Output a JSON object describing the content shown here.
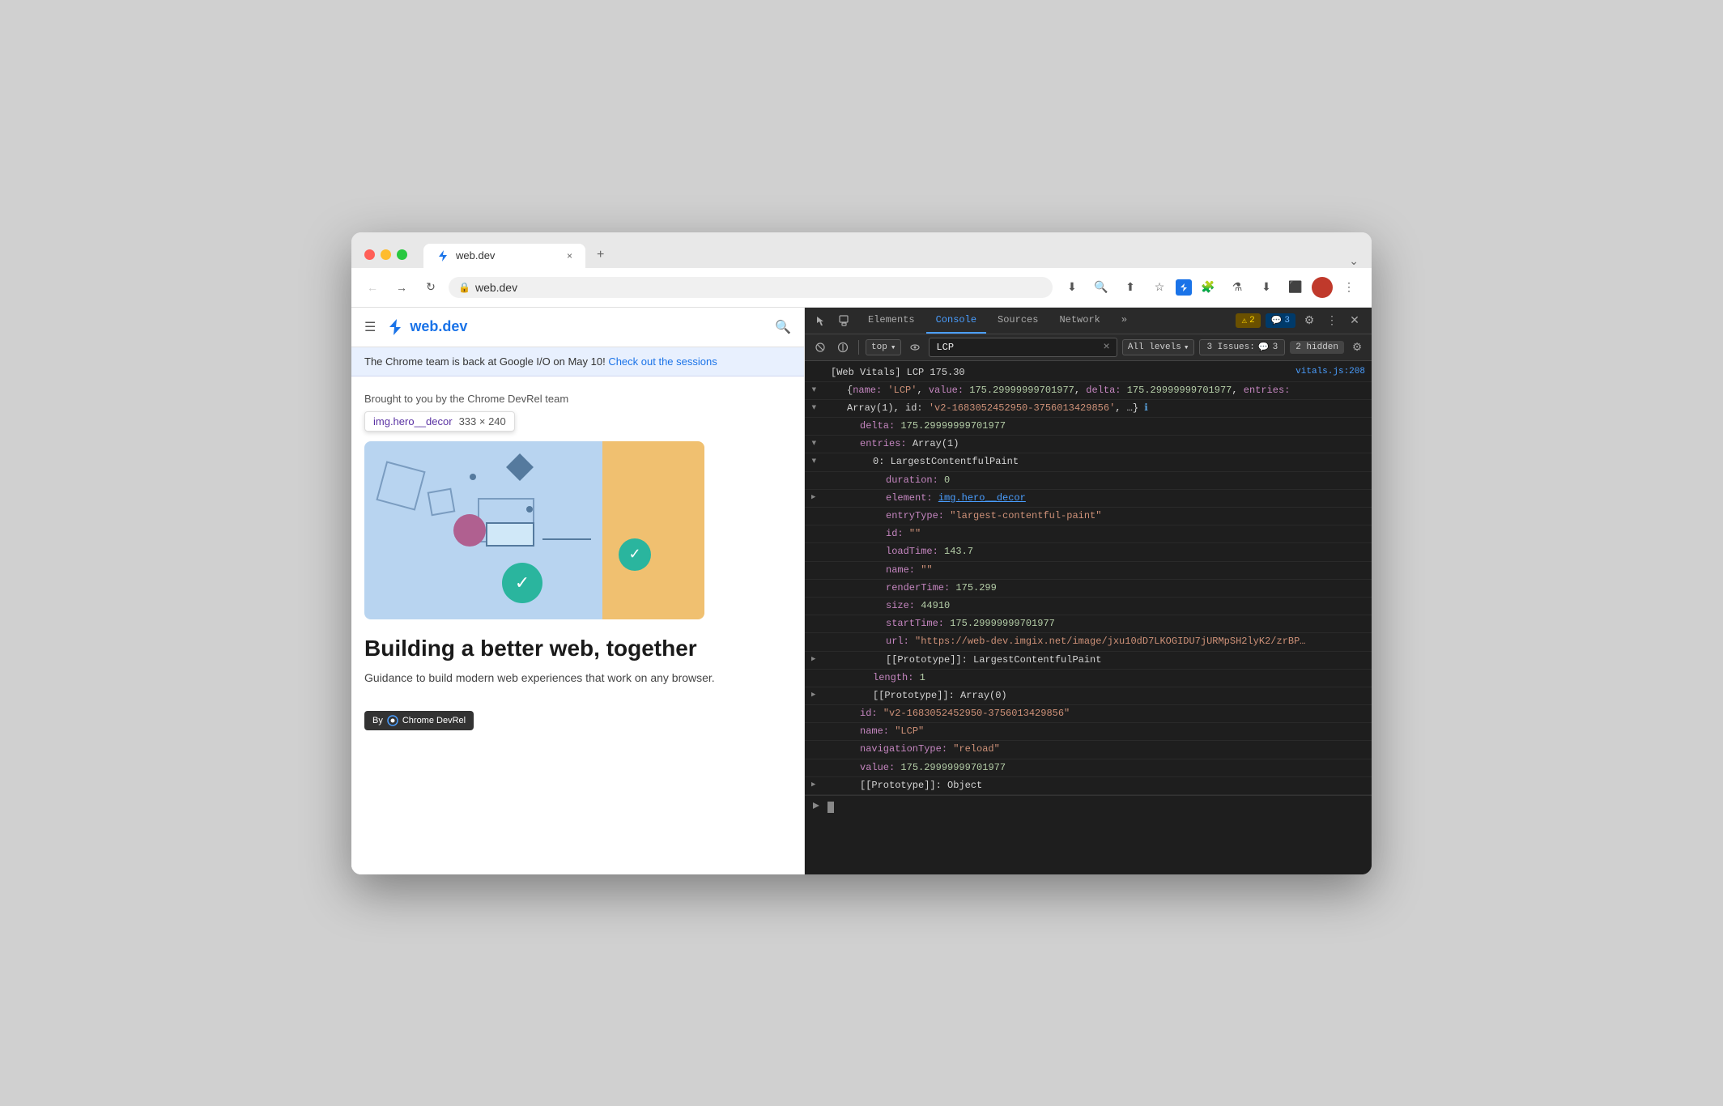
{
  "browser": {
    "traffic_lights": [
      "red",
      "yellow",
      "green"
    ],
    "tab": {
      "title": "web.dev",
      "close_label": "×",
      "new_tab_label": "+"
    },
    "nav": {
      "back_label": "←",
      "forward_label": "→",
      "refresh_label": "↻",
      "address": "web.dev",
      "lock_icon": "🔒",
      "bookmark_label": "☆",
      "more_label": "⋮"
    }
  },
  "page": {
    "nav": {
      "hamburger_label": "≡",
      "site_name": "web.dev",
      "search_label": "🔍"
    },
    "announcement": {
      "text": "The Chrome team is back at Google I/O on May 10! ",
      "link_text": "Check out the sessions"
    },
    "hero": {
      "by_text": "Brought to you by the Chrome DevRel team",
      "element_tooltip": {
        "tag": "img.hero__decor",
        "size": "333 × 240"
      },
      "title": "Building a better web, together",
      "subtitle": "Guidance to build modern web experiences that work on any browser."
    },
    "footer_badge": {
      "label": "By",
      "name": "Chrome DevRel"
    }
  },
  "devtools": {
    "tabs": [
      "Elements",
      "Console",
      "Sources",
      "Network"
    ],
    "active_tab": "Console",
    "more_tabs_label": "»",
    "badges": {
      "warn_icon": "⚠",
      "warn_count": "2",
      "info_icon": "💬",
      "info_count": "3"
    },
    "toolbar": {
      "clear_label": "🚫",
      "stop_label": "⊘",
      "context": "top",
      "eye_label": "👁",
      "filter_value": "LCP",
      "filter_clear": "×",
      "level": "All levels",
      "issues_label": "3 Issues:",
      "issues_count": "3",
      "hidden_count": "2 hidden"
    },
    "console_output": [
      {
        "type": "log",
        "gutter": "",
        "indent": 0,
        "content": "[Web Vitals] LCP 175.30",
        "source": "vitals.js:208",
        "parts": [
          {
            "text": "[Web Vitals] LCP 175.30",
            "class": "c-white"
          }
        ]
      },
      {
        "type": "obj",
        "indent": 1,
        "expand": true,
        "parts": [
          {
            "text": "{",
            "class": "c-white"
          },
          {
            "text": "name: ",
            "class": "c-purple"
          },
          {
            "text": "'LCP'",
            "class": "c-orange"
          },
          {
            "text": ", value: ",
            "class": "c-purple"
          },
          {
            "text": "175.29999999701977",
            "class": "c-num"
          },
          {
            "text": ", delta: ",
            "class": "c-purple"
          },
          {
            "text": "175.29999999701977",
            "class": "c-num"
          },
          {
            "text": ", entries:",
            "class": "c-purple"
          }
        ]
      },
      {
        "type": "obj",
        "indent": 1,
        "expand": true,
        "parts": [
          {
            "text": "Array(1), id: ",
            "class": "c-white"
          },
          {
            "text": "'v2-1683052452950-3756013429856'",
            "class": "c-orange"
          },
          {
            "text": ", …}",
            "class": "c-white"
          },
          {
            "text": " ℹ",
            "class": "c-blue"
          }
        ]
      },
      {
        "type": "prop",
        "indent": 2,
        "parts": [
          {
            "text": "delta: ",
            "class": "c-purple"
          },
          {
            "text": "175.29999999701977",
            "class": "c-num"
          }
        ]
      },
      {
        "type": "prop-expand",
        "indent": 2,
        "expand": true,
        "parts": [
          {
            "text": "entries: ",
            "class": "c-purple"
          },
          {
            "text": "Array(1)",
            "class": "c-white"
          }
        ]
      },
      {
        "type": "prop-expand",
        "indent": 3,
        "expand": true,
        "parts": [
          {
            "text": "0: LargestContentfulPaint",
            "class": "c-white"
          }
        ]
      },
      {
        "type": "prop",
        "indent": 4,
        "parts": [
          {
            "text": "duration: ",
            "class": "c-purple"
          },
          {
            "text": "0",
            "class": "c-num"
          }
        ]
      },
      {
        "type": "prop-expand",
        "indent": 4,
        "expand": false,
        "parts": [
          {
            "text": "element: ",
            "class": "c-purple"
          },
          {
            "text": "img.hero__decor",
            "class": "c-link"
          }
        ]
      },
      {
        "type": "prop",
        "indent": 4,
        "parts": [
          {
            "text": "entryType: ",
            "class": "c-purple"
          },
          {
            "text": "\"largest-contentful-paint\"",
            "class": "c-orange"
          }
        ]
      },
      {
        "type": "prop",
        "indent": 4,
        "parts": [
          {
            "text": "id: ",
            "class": "c-purple"
          },
          {
            "text": "\"\"",
            "class": "c-orange"
          }
        ]
      },
      {
        "type": "prop",
        "indent": 4,
        "parts": [
          {
            "text": "loadTime: ",
            "class": "c-purple"
          },
          {
            "text": "143.7",
            "class": "c-num"
          }
        ]
      },
      {
        "type": "prop",
        "indent": 4,
        "parts": [
          {
            "text": "name: ",
            "class": "c-purple"
          },
          {
            "text": "\"\"",
            "class": "c-orange"
          }
        ]
      },
      {
        "type": "prop",
        "indent": 4,
        "parts": [
          {
            "text": "renderTime: ",
            "class": "c-purple"
          },
          {
            "text": "175.299",
            "class": "c-num"
          }
        ]
      },
      {
        "type": "prop",
        "indent": 4,
        "parts": [
          {
            "text": "size: ",
            "class": "c-purple"
          },
          {
            "text": "44910",
            "class": "c-num"
          }
        ]
      },
      {
        "type": "prop",
        "indent": 4,
        "parts": [
          {
            "text": "startTime: ",
            "class": "c-purple"
          },
          {
            "text": "175.29999999701977",
            "class": "c-num"
          }
        ]
      },
      {
        "type": "prop",
        "indent": 4,
        "parts": [
          {
            "text": "url: ",
            "class": "c-purple"
          },
          {
            "text": "\"https://web-dev.imgix.net/image/jxu10dD7LKOGIDU7jURMpSH2lyK2/zrBP…",
            "class": "c-orange"
          }
        ]
      },
      {
        "type": "prop-expand",
        "indent": 4,
        "expand": false,
        "parts": [
          {
            "text": "▶ [[Prototype]]: LargestContentfulPaint",
            "class": "c-white"
          }
        ]
      },
      {
        "type": "prop",
        "indent": 3,
        "parts": [
          {
            "text": "length: ",
            "class": "c-purple"
          },
          {
            "text": "1",
            "class": "c-num"
          }
        ]
      },
      {
        "type": "prop-expand",
        "indent": 3,
        "expand": false,
        "parts": [
          {
            "text": "▶ [[Prototype]]: Array(0)",
            "class": "c-white"
          }
        ]
      },
      {
        "type": "prop",
        "indent": 2,
        "parts": [
          {
            "text": "id: ",
            "class": "c-purple"
          },
          {
            "text": "\"v2-1683052452950-3756013429856\"",
            "class": "c-orange"
          }
        ]
      },
      {
        "type": "prop",
        "indent": 2,
        "parts": [
          {
            "text": "name: ",
            "class": "c-purple"
          },
          {
            "text": "\"LCP\"",
            "class": "c-orange"
          }
        ]
      },
      {
        "type": "prop",
        "indent": 2,
        "parts": [
          {
            "text": "navigationType: ",
            "class": "c-purple"
          },
          {
            "text": "\"reload\"",
            "class": "c-orange"
          }
        ]
      },
      {
        "type": "prop",
        "indent": 2,
        "parts": [
          {
            "text": "value: ",
            "class": "c-purple"
          },
          {
            "text": "175.29999999701977",
            "class": "c-num"
          }
        ]
      },
      {
        "type": "prop-expand",
        "indent": 2,
        "expand": false,
        "parts": [
          {
            "text": "▶ [[Prototype]]: Object",
            "class": "c-white"
          }
        ]
      }
    ],
    "prompt_label": ">"
  }
}
